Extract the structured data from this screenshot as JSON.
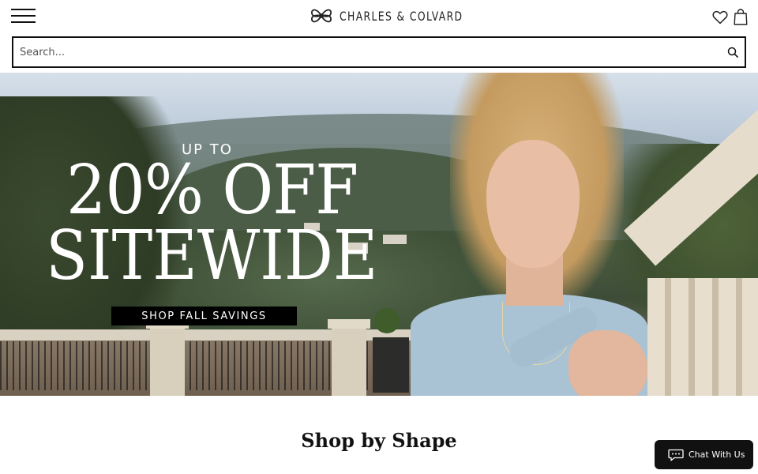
{
  "header": {
    "menu_icon": "hamburger-menu-icon",
    "brand_name": "CHARLES & COLVARD",
    "logo_icon": "charles-colvard-logo-icon",
    "wishlist_icon": "heart-icon",
    "bag_icon": "shopping-bag-icon"
  },
  "search": {
    "placeholder": "Search...",
    "icon": "search-icon"
  },
  "hero": {
    "eyebrow": "UP TO",
    "headline_line1": "20% OFF",
    "asterisk": "*",
    "headline_line2": "SITEWIDE",
    "cta_label": "SHOP FALL SAVINGS"
  },
  "section": {
    "title": "Shop by Shape"
  },
  "chat": {
    "label": "Chat With Us",
    "icon": "chat-bubble-icon"
  },
  "colors": {
    "text": "#111111",
    "cta_background": "#000000",
    "hero_text": "#ffffff"
  }
}
